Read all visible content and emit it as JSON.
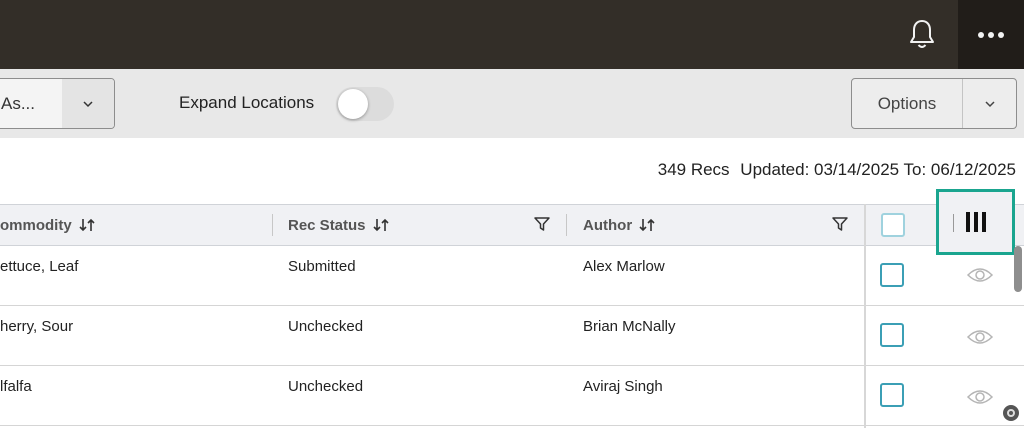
{
  "header": {
    "bell_icon": "bell-icon",
    "more_icon": "more-horizontal-icon"
  },
  "toolbar": {
    "save_as_label": "As...",
    "expand_locations_label": "Expand Locations",
    "expand_locations_on": false,
    "options_label": "Options"
  },
  "summary": {
    "count": "349 Recs",
    "updated": "Updated: 03/14/2025 To: 06/12/2025"
  },
  "columns": {
    "commodity": "ommodity",
    "rec_status": "Rec Status",
    "author": "Author"
  },
  "rows": [
    {
      "commodity": "ettuce, Leaf",
      "rec_status": "Submitted",
      "author": "Alex Marlow"
    },
    {
      "commodity": "herry, Sour",
      "rec_status": "Unchecked",
      "author": "Brian McNally"
    },
    {
      "commodity": "lfalfa",
      "rec_status": "Unchecked",
      "author": "Aviraj Singh"
    }
  ],
  "colors": {
    "topbar": "#332e28",
    "accent_teal": "#1aa58f",
    "checkbox_blue": "#3b9fb5"
  }
}
